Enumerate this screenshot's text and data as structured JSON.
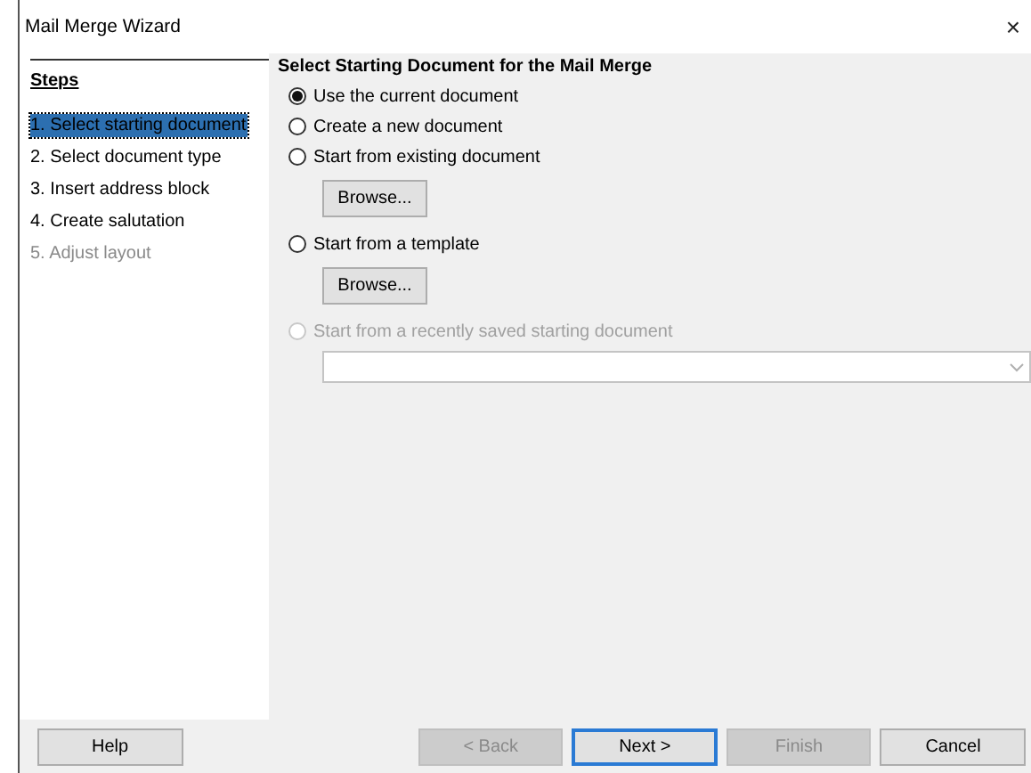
{
  "window": {
    "title": "Mail Merge Wizard",
    "close": "×"
  },
  "steps": {
    "heading": "Steps",
    "items": [
      {
        "label": "1. Select starting document",
        "selected": true,
        "disabled": false
      },
      {
        "label": "2. Select document type",
        "selected": false,
        "disabled": false
      },
      {
        "label": "3. Insert address block",
        "selected": false,
        "disabled": false
      },
      {
        "label": "4. Create salutation",
        "selected": false,
        "disabled": false
      },
      {
        "label": "5. Adjust layout",
        "selected": false,
        "disabled": true
      }
    ]
  },
  "page": {
    "heading": "Select Starting Document for the Mail Merge",
    "options": [
      {
        "kind": "radio",
        "label": "Use the current document",
        "selected": true,
        "disabled": false
      },
      {
        "kind": "radio",
        "label": "Create a new document",
        "selected": false,
        "disabled": false
      },
      {
        "kind": "radio",
        "label": "Start from existing document",
        "selected": false,
        "disabled": false
      },
      {
        "kind": "button",
        "label": "Browse..."
      },
      {
        "kind": "radio",
        "label": "Start from a template",
        "selected": false,
        "disabled": false
      },
      {
        "kind": "button",
        "label": "Browse..."
      },
      {
        "kind": "radio",
        "label": "Start from a recently saved starting document",
        "selected": false,
        "disabled": true
      },
      {
        "kind": "combo",
        "disabled": true
      }
    ]
  },
  "buttons": [
    {
      "label": "Help",
      "disabled": false,
      "default": false
    },
    {
      "label": "< Back",
      "disabled": true,
      "default": false
    },
    {
      "label": "Next >",
      "disabled": false,
      "default": true
    },
    {
      "label": "Finish",
      "disabled": true,
      "default": false
    },
    {
      "label": "Cancel",
      "disabled": false,
      "default": false
    }
  ]
}
